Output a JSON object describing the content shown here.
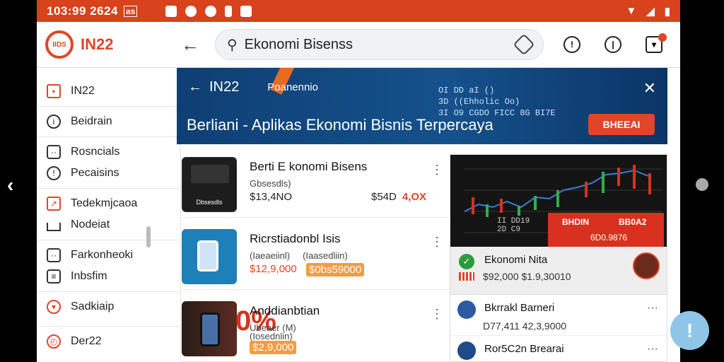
{
  "status": {
    "time": "103:99 2624",
    "label": "as"
  },
  "app": {
    "logo_mark": "IIDS",
    "logo_text": "IN22"
  },
  "search": {
    "value": "Ekonomi Bisenss",
    "placeholder": "Ekonomi Bisenss"
  },
  "sidebar": {
    "items": [
      {
        "label": "IN22",
        "icon": "portfolio-icon"
      },
      {
        "label": "Beidrain",
        "icon": "info-icon"
      },
      {
        "label": "Rosncials",
        "icon": "chat-icon"
      },
      {
        "label": "Pecaisins",
        "icon": "info-icon"
      },
      {
        "label": "Tedekmjcaoa",
        "icon": "trend-icon"
      },
      {
        "label": "Nodeiat",
        "icon": "home-icon"
      },
      {
        "label": "Farkonheoki",
        "icon": "chat-icon"
      },
      {
        "label": "Inbsfim",
        "icon": "book-icon"
      },
      {
        "label": "Sadkiaip",
        "icon": "shield-icon"
      },
      {
        "label": "Der22",
        "icon": "clock-icon"
      }
    ]
  },
  "banner": {
    "title": "IN22",
    "subtitle": "Poanennio",
    "info_line1": "OI DD aI ()",
    "info_line2": "3D ((Ehholic Oo)",
    "info_line3": "3I O9 CGDO FICC 8G BI7E",
    "headline": "Berliani - Aplikas Ekonomi Bisnis Terpercaya",
    "cta": "BHEEAI"
  },
  "cards": [
    {
      "title": "Berti E konomi Bisens",
      "sub": "Gbsesdls)",
      "price": "$13,4NO",
      "price2": "$54D",
      "price2_red": "4,OX",
      "thumb_label": "Dbsesdls"
    },
    {
      "title": "Ricrstiadonbl Isis",
      "sub": "(Iaeaeiinl)",
      "sub2": "(Iaasedliin)",
      "price": "$12,9,000",
      "price2": "$0bs59000",
      "thumb_label": ""
    },
    {
      "title": "Anddianbtian",
      "sub": "Ubeaer (M)",
      "sub2": "(Iosednlin)",
      "price": "$2,9,000",
      "price2": "",
      "thumb_label": "0%"
    }
  ],
  "panel": {
    "chart_label1": "II DD19",
    "chart_label2": "2D C9",
    "tab1": "BHDIN",
    "tab2": "BB0A2",
    "tab_value": "6D0.9876",
    "featured": {
      "title": "Ekonomi Nita",
      "price": "$92,000 $1.9,30010"
    },
    "items": [
      {
        "title": "Bkrrakl Barneri",
        "price": "D77,411 42,3,9000"
      },
      {
        "title": "Ror5C2n Brearai",
        "price": ""
      }
    ]
  },
  "fab": {
    "label": "!"
  }
}
